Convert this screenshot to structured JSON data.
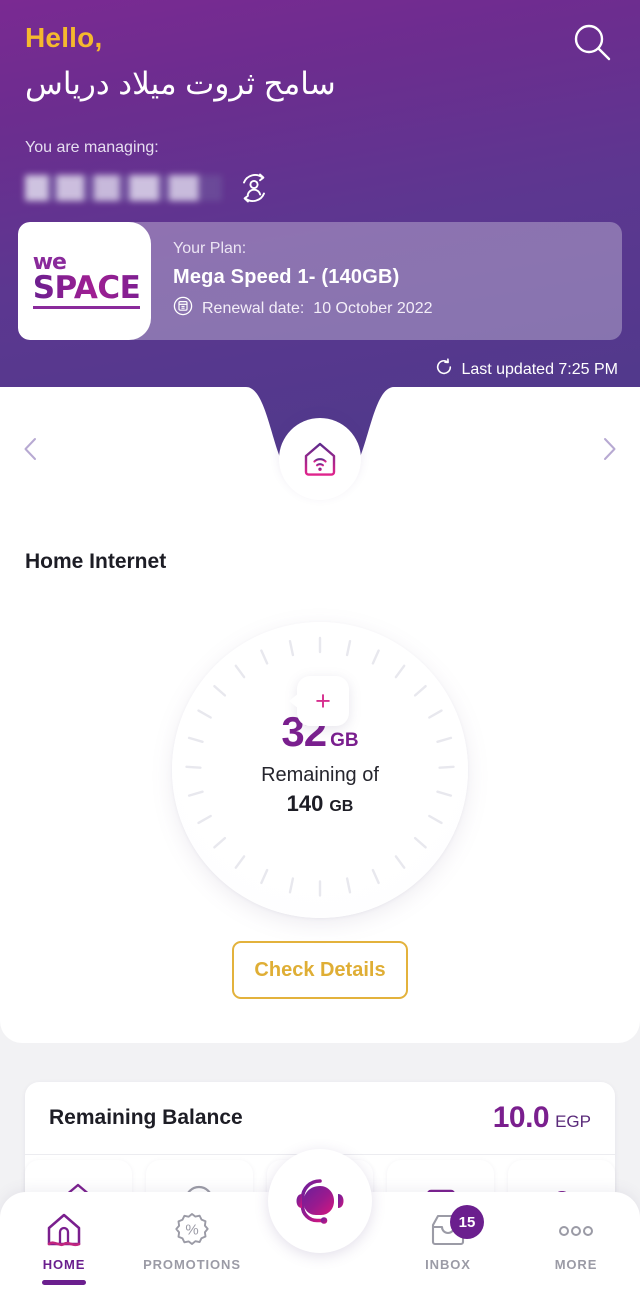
{
  "header": {
    "greeting": "Hello,",
    "username": "سامح ثروت ميلاد درياس",
    "managing_label": "You are managing:",
    "managing_account": "",
    "search_icon": "search-icon",
    "switch_account_icon": "switch-account-icon",
    "last_updated": "Last updated 7:25 PM",
    "refresh_icon": "refresh-icon",
    "prev_icon": "chevron-left-icon",
    "next_icon": "chevron-right-icon",
    "service_icon": "home-wifi-icon"
  },
  "plan": {
    "logo_we": "we",
    "logo_space": "SPACE",
    "label": "Your Plan:",
    "name": "Mega Speed 1- (140GB)",
    "renewal_label": "Renewal date:",
    "renewal_date": "10 October 2022",
    "renewal_icon": "calendar-renewal-icon"
  },
  "main": {
    "section_title": "Home Internet",
    "gauge": {
      "remaining_value": "32",
      "remaining_unit": "GB",
      "middle_text": "Remaining of",
      "total_value": "140",
      "total_unit": "GB"
    },
    "addon_button_icon": "plus-icon",
    "check_details_label": "Check Details"
  },
  "balance": {
    "label": "Remaining Balance",
    "value": "10.0",
    "currency": "EGP"
  },
  "support": {
    "icon": "headset-support-icon"
  },
  "bottom_nav": {
    "items": [
      {
        "label": "HOME",
        "icon": "home-icon",
        "active": true,
        "badge": ""
      },
      {
        "label": "PROMOTIONS",
        "icon": "percent-icon",
        "active": false,
        "badge": ""
      },
      {
        "label": "INBOX",
        "icon": "inbox-icon",
        "active": false,
        "badge": "15"
      },
      {
        "label": "MORE",
        "icon": "more-dots-icon",
        "active": false,
        "badge": ""
      }
    ]
  },
  "colors": {
    "brand_purple": "#6b1f8e",
    "header_top": "#7a2a92",
    "header_bottom": "#52398c",
    "accent_gold": "#e3b23c",
    "accent_magenta": "#d6308f",
    "greeting_yellow": "#f5b92e"
  }
}
